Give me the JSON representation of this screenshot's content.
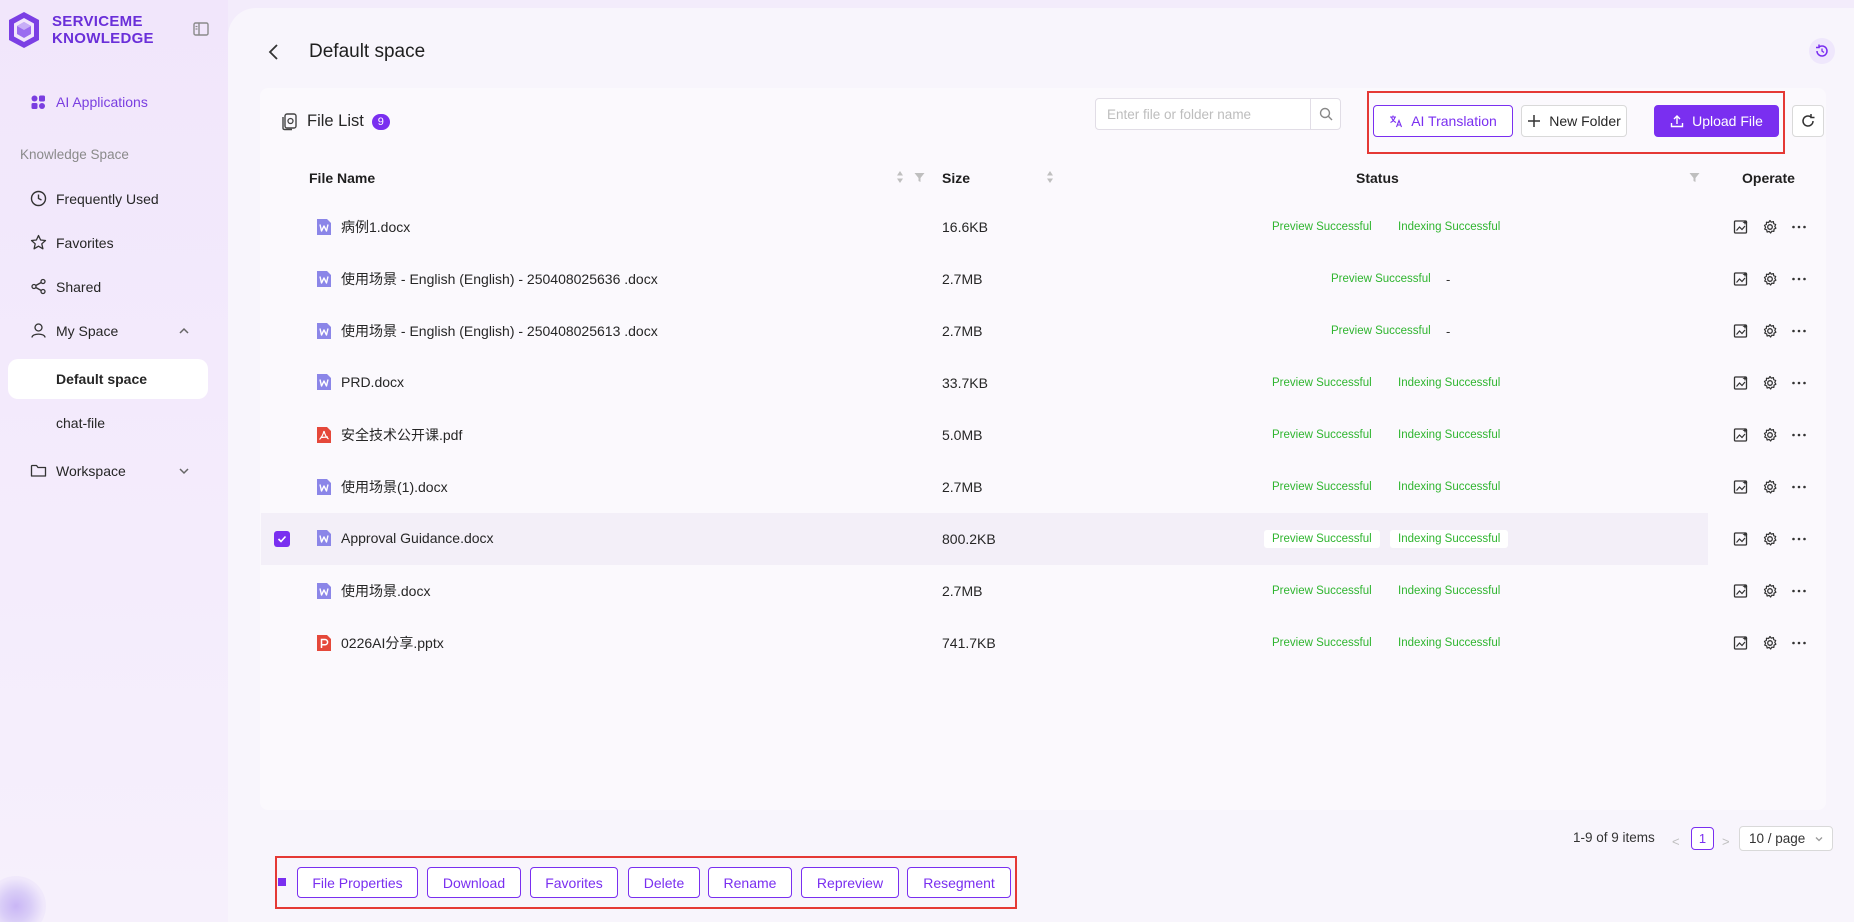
{
  "brand": {
    "line1": "SERVICEME",
    "line2": "KNOWLEDGE",
    "color": "#6a2fd9"
  },
  "sidebar": {
    "ai_applications": "AI Applications",
    "section_label": "Knowledge Space",
    "items": [
      {
        "label": "Frequently Used",
        "icon": "clock-icon"
      },
      {
        "label": "Favorites",
        "icon": "star-icon"
      },
      {
        "label": "Shared",
        "icon": "share-icon"
      },
      {
        "label": "My Space",
        "icon": "user-icon",
        "expanded": true
      }
    ],
    "my_space_children": [
      {
        "label": "Default space",
        "active": true
      },
      {
        "label": "chat-file",
        "active": false
      }
    ],
    "workspace": {
      "label": "Workspace",
      "icon": "folder-icon",
      "expanded": false
    }
  },
  "header": {
    "title": "Default space"
  },
  "file_list": {
    "title": "File List",
    "count": "9",
    "search_placeholder": "Enter file or folder name",
    "actions": {
      "ai_translation": "AI Translation",
      "new_folder": "New Folder",
      "upload_file": "Upload File"
    },
    "columns": {
      "name": "File Name",
      "size": "Size",
      "status": "Status",
      "operate": "Operate"
    },
    "rows": [
      {
        "name": "病例1.docx",
        "type": "word",
        "size": "16.6KB",
        "preview": "Preview Successful",
        "index": "Indexing Successful",
        "selected": false
      },
      {
        "name": "使用场景 - English (English) - 250408025636 .docx",
        "type": "word",
        "size": "2.7MB",
        "preview": "Preview Successful",
        "index": "-",
        "selected": false
      },
      {
        "name": "使用场景 - English (English) - 250408025613 .docx",
        "type": "word",
        "size": "2.7MB",
        "preview": "Preview Successful",
        "index": "-",
        "selected": false
      },
      {
        "name": "PRD.docx",
        "type": "word",
        "size": "33.7KB",
        "preview": "Preview Successful",
        "index": "Indexing Successful",
        "selected": false
      },
      {
        "name": "安全技术公开课.pdf",
        "type": "pdf",
        "size": "5.0MB",
        "preview": "Preview Successful",
        "index": "Indexing Successful",
        "selected": false
      },
      {
        "name": "使用场景(1).docx",
        "type": "word",
        "size": "2.7MB",
        "preview": "Preview Successful",
        "index": "Indexing Successful",
        "selected": false
      },
      {
        "name": "Approval Guidance.docx",
        "type": "word",
        "size": "800.2KB",
        "preview": "Preview Successful",
        "index": "Indexing Successful",
        "selected": true
      },
      {
        "name": "使用场景.docx",
        "type": "word",
        "size": "2.7MB",
        "preview": "Preview Successful",
        "index": "Indexing Successful",
        "selected": false
      },
      {
        "name": "0226AI分享.pptx",
        "type": "ppt",
        "size": "741.7KB",
        "preview": "Preview Successful",
        "index": "Indexing Successful",
        "selected": false
      }
    ]
  },
  "pagination": {
    "summary": "1-9 of 9 items",
    "current": "1",
    "page_size": "10 / page"
  },
  "bulk_actions": {
    "file_properties": "File Properties",
    "download": "Download",
    "favorites": "Favorites",
    "delete": "Delete",
    "rename": "Rename",
    "repreview": "Repreview",
    "resegment": "Resegment"
  },
  "colors": {
    "accent": "#7a2ff0",
    "success": "#2fb52f",
    "highlight": "#e53935"
  }
}
